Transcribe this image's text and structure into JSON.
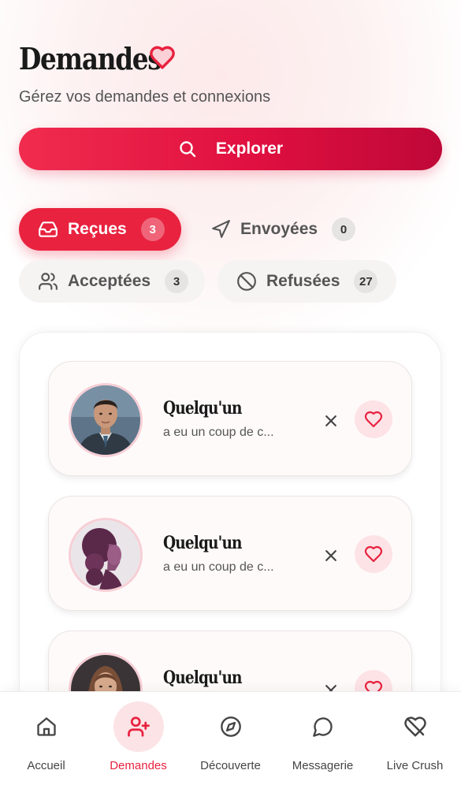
{
  "header": {
    "title": "Demandes",
    "subtitle": "Gérez vos demandes et connexions"
  },
  "explore_button": {
    "label": "Explorer"
  },
  "tabs": [
    {
      "label": "Reçues",
      "count": "3",
      "icon": "inbox-icon",
      "active": true
    },
    {
      "label": "Envoyées",
      "count": "0",
      "icon": "send-icon",
      "active": false
    },
    {
      "label": "Acceptées",
      "count": "3",
      "icon": "users-icon",
      "active": false
    },
    {
      "label": "Refusées",
      "count": "27",
      "icon": "ban-icon",
      "active": false
    }
  ],
  "requests": [
    {
      "name": "Quelqu'un",
      "message": "a eu un coup de c...",
      "avatar": "man-suit-photo"
    },
    {
      "name": "Quelqu'un",
      "message": "a eu un coup de c...",
      "avatar": "woman-purple-profile-photo"
    },
    {
      "name": "Quelqu'un",
      "message": "",
      "avatar": "woman-long-hair-photo"
    }
  ],
  "bottom_nav": [
    {
      "label": "Accueil",
      "icon": "home-icon",
      "active": false
    },
    {
      "label": "Demandes",
      "icon": "user-plus-icon",
      "active": true
    },
    {
      "label": "Découverte",
      "icon": "compass-icon",
      "active": false
    },
    {
      "label": "Messagerie",
      "icon": "chat-bubble-icon",
      "active": false
    },
    {
      "label": "Live Crush",
      "icon": "heart-crossed-icon",
      "active": false
    }
  ],
  "colors": {
    "accent": "#e8223f",
    "accent_dark": "#bf0838",
    "like_bg": "#fde3e6"
  }
}
